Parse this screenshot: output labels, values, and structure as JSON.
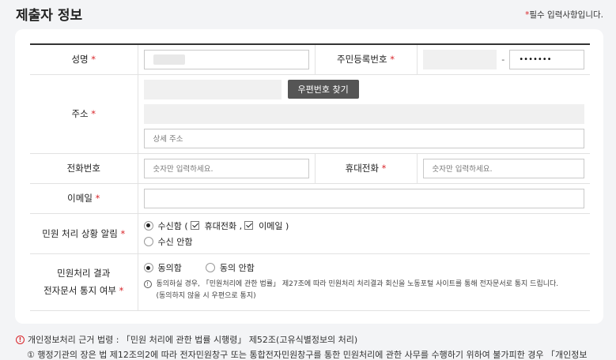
{
  "section": {
    "title": "제출자 정보",
    "required_note_mark": "*",
    "required_note_text": "필수 입력사항입니다."
  },
  "required_mark": "*",
  "fields": {
    "name": {
      "label": "성명"
    },
    "rrn": {
      "label": "주민등록번호",
      "separator": "-",
      "back_value": "•••••••"
    },
    "address": {
      "label": "주소",
      "zip_button": "우편번호 찾기",
      "detail_placeholder": "상세 주소"
    },
    "phone": {
      "label": "전화번호",
      "placeholder": "숫자만 입력하세요."
    },
    "mobile": {
      "label": "휴대전화",
      "placeholder": "숫자만 입력하세요."
    },
    "email": {
      "label": "이메일"
    },
    "alert": {
      "label": "민원 처리 상황 알림",
      "receive": "수신함 (",
      "mobile_opt": "휴대전화 ,",
      "email_opt": "이메일 )",
      "no_receive": "수신 안함"
    },
    "edoc": {
      "label_line1": "민원처리 결과",
      "label_line2": "전자문서 통지 여부",
      "agree": "동의함",
      "disagree": "동의 안함",
      "notice1": "동의하실 경우, 「민원처리에 관한 법률」 제27조에 따라 민원처리 처리결과 회신을 노동포털 사이트를 통해 전자문서로 통지 드립니다.",
      "notice2": "(동의하지 않을 시 우편으로 통지)"
    }
  },
  "footer": {
    "line1": "개인정보처리 근거 법령 : 「민원 처리에 관한 법률 시행령」 제52조(고유식별정보의 처리)",
    "line2": "① 행정기관의 장은 법 제12조의2에 따라 전자민원창구 또는 통합전자민원창구를 통한 민원처리에 관한 사무를 수행하기 위하여 불가피한 경우 「개인정보"
  },
  "colors": {
    "required": "#d9262b",
    "button": "#555555"
  }
}
